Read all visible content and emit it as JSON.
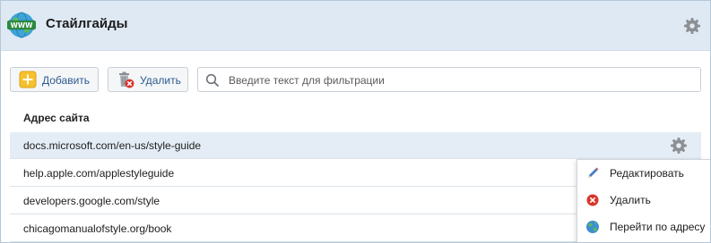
{
  "header": {
    "title": "Стайлгайды",
    "app_icon_text": "WWW",
    "settings_icon": "gear-icon"
  },
  "toolbar": {
    "add_label": "Добавить",
    "delete_label": "Удалить",
    "filter_placeholder": "Введите текст для фильтрации",
    "filter_value": ""
  },
  "table": {
    "column_header": "Адрес сайта",
    "rows": [
      {
        "url": "docs.microsoft.com/en-us/style-guide",
        "selected": true
      },
      {
        "url": "help.apple.com/applestyleguide",
        "selected": false
      },
      {
        "url": "developers.google.com/style",
        "selected": false
      },
      {
        "url": "chicagomanualofstyle.org/book",
        "selected": false
      }
    ]
  },
  "context_menu": {
    "items": [
      {
        "label": "Редактировать",
        "icon": "pencil-icon"
      },
      {
        "label": "Удалить",
        "icon": "delete-icon"
      },
      {
        "label": "Перейти по адресу",
        "icon": "globe-icon"
      }
    ]
  },
  "colors": {
    "header_bg": "#dfe9f4",
    "selected_row_bg": "#e4edf6",
    "button_text": "#2c5a8e",
    "delete_red": "#d9342b",
    "add_yellow": "#f7c12e"
  }
}
